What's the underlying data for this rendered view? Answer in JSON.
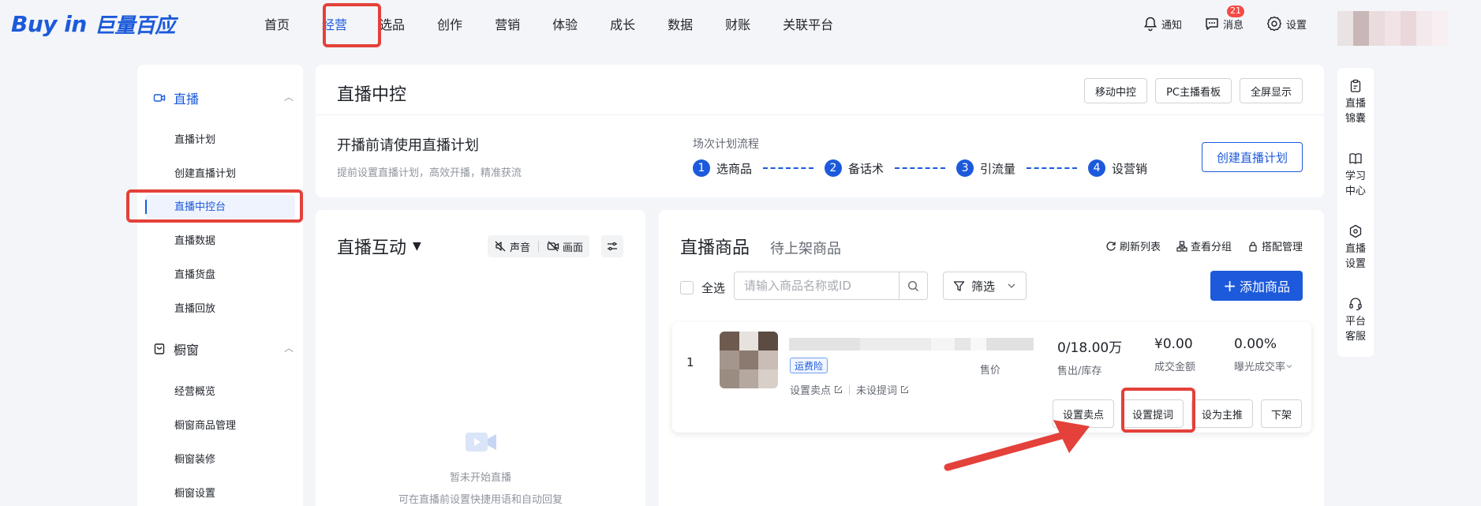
{
  "topnav": {
    "logo_en": "Buy in",
    "logo_cn": "巨量百应",
    "items": [
      "首页",
      "经营",
      "选品",
      "创作",
      "营销",
      "体验",
      "成长",
      "数据",
      "财账",
      "关联平台"
    ],
    "active": "经营",
    "notify_label": "通知",
    "message_label": "消息",
    "message_badge": "21",
    "settings_label": "设置"
  },
  "sidebar": {
    "group1": "直播",
    "group1_items": [
      "直播计划",
      "创建直播计划",
      "直播中控台",
      "直播数据",
      "直播货盘",
      "直播回放"
    ],
    "active_item": "直播中控台",
    "group2": "橱窗",
    "group2_items": [
      "经营概览",
      "橱窗商品管理",
      "橱窗装修",
      "橱窗设置"
    ]
  },
  "header": {
    "title": "直播中控",
    "buttons": [
      "移动中控",
      "PC主播看板",
      "全屏显示"
    ],
    "plan_title": "开播前请使用直播计划",
    "plan_sub": "提前设置直播计划，高效开播，精准获流",
    "flow_label": "场次计划流程",
    "steps": [
      {
        "num": "1",
        "label": "选商品"
      },
      {
        "num": "2",
        "label": "备话术"
      },
      {
        "num": "3",
        "label": "引流量"
      },
      {
        "num": "4",
        "label": "设营销"
      }
    ],
    "create_plan_button": "创建直播计划"
  },
  "interaction": {
    "title": "直播互动",
    "caret": "▼",
    "sound_label": "声音",
    "screen_label": "画面",
    "empty_title": "暂未开始直播",
    "empty_sub": "可在直播前设置快捷用语和自动回复"
  },
  "products": {
    "tab_active": "直播商品",
    "tab_other": "待上架商品",
    "actions": [
      "刷新列表",
      "查看分组",
      "搭配管理"
    ],
    "select_all": "全选",
    "search_placeholder": "请输入商品名称或ID",
    "filter_label": "筛选",
    "add_button": "添加商品",
    "row": {
      "index": "1",
      "tag": "运费险",
      "link_selling_point": "设置卖点",
      "link_prompt": "未设提词",
      "price_label": "售价",
      "stats": [
        {
          "value": "0/18.00万",
          "label": "售出/库存"
        },
        {
          "value": "¥0.00",
          "label": "成交金额"
        },
        {
          "value": "0.00%",
          "label": "曝光成交率"
        }
      ],
      "buttons": [
        "设置卖点",
        "设置提词",
        "设为主推",
        "下架"
      ]
    }
  },
  "rail": [
    {
      "l1": "直播",
      "l2": "锦囊"
    },
    {
      "l1": "学习",
      "l2": "中心"
    },
    {
      "l1": "直播",
      "l2": "设置"
    },
    {
      "l1": "平台",
      "l2": "客服"
    }
  ],
  "colors": {
    "accent": "#1c5adb",
    "highlight": "#e3413a",
    "badge": "#f54a45"
  }
}
